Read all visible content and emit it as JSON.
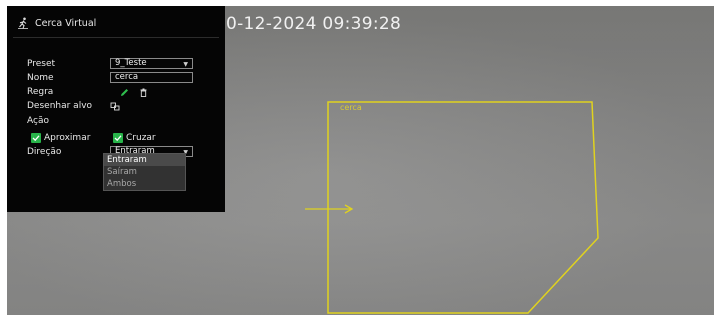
{
  "video": {
    "timestamp": "0-12-2024 09:39:28",
    "zone_label": "cerca"
  },
  "panel": {
    "title": "Cerca Virtual",
    "preset_label": "Preset",
    "preset_value": "9_Teste",
    "name_label": "Nome",
    "name_value": "cerca",
    "rule_label": "Regra",
    "draw_target_label": "Desenhar alvo",
    "action_label": "Ação",
    "approach_label": "Aproximar",
    "cross_label": "Cruzar",
    "direction_label": "Direção",
    "direction_value": "Entraram",
    "direction_options": [
      "Entraram",
      "Saíram",
      "Ambos"
    ]
  },
  "colors": {
    "zone": "#e0d21f",
    "arrow": "#e0d21f",
    "check": "#28b44a",
    "edit": "#2fbf4e"
  }
}
